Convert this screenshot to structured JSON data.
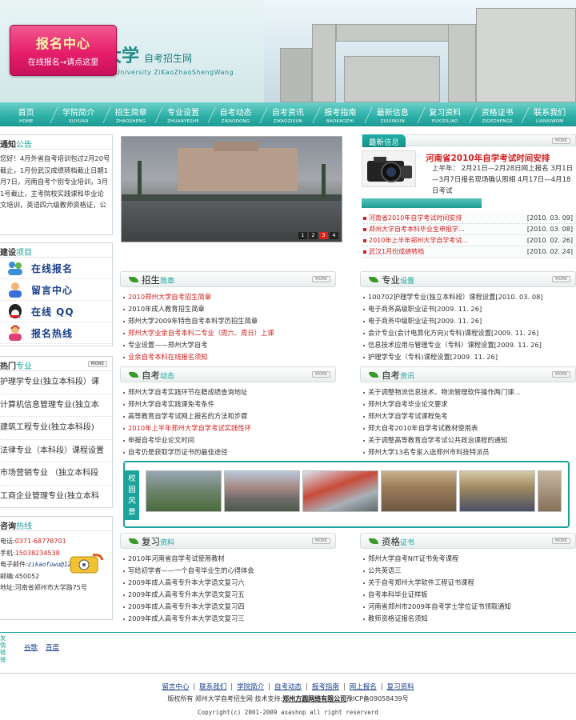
{
  "header": {
    "logo_cn": "大学",
    "logo_site": "自考招生网",
    "logo_en": "ou University ZiKaoZhaoShengWang",
    "signup_title": "报名中心",
    "signup_sub": "在线报名→请点这里"
  },
  "nav": [
    {
      "cn": "首页",
      "en": "HOME"
    },
    {
      "cn": "学院简介",
      "en": "XUYUAN"
    },
    {
      "cn": "招生简章",
      "en": "ZHAOSHENG"
    },
    {
      "cn": "专业设置",
      "en": "ZHUANYESHE"
    },
    {
      "cn": "自考动态",
      "en": "ZIKAODONG"
    },
    {
      "cn": "自考资讯",
      "en": "ZIKAOZIXUN"
    },
    {
      "cn": "报考指南",
      "en": "BAOKAOZHI"
    },
    {
      "cn": "最新信息",
      "en": "ZUIXINXIN"
    },
    {
      "cn": "复习资料",
      "en": "FUXIZILIAO"
    },
    {
      "cn": "资格证书",
      "en": "ZIGEZHENGS"
    },
    {
      "cn": "联系我们",
      "en": "LIANXIWOM"
    }
  ],
  "notice": {
    "title_a": "通知",
    "title_b": "公告",
    "text": "您好！4月外省自考培训包过2月20号截止，1月份武汉成绩转档截止日期1月7日，河南自考个别专业培训，3月1号截止，主考院校实践课和毕业论文培训，英语四六级教师资格证，公"
  },
  "services": {
    "title_a": "建设",
    "title_b": "项目",
    "items": [
      "在线报名",
      "留言中心",
      "在线 QQ",
      "报名热线"
    ]
  },
  "majors": {
    "title_a": "热门",
    "title_b": "专业",
    "more": "MORE",
    "items": [
      "护理学专业(独立本科段）课",
      "计算机信息管理专业(独立本",
      "建筑工程专业(独立本科段)",
      "法律专业（本科段）课程设置",
      "市场营销专业 （独立本科段",
      "工商企业管理专业(独立本科"
    ]
  },
  "contact": {
    "title_a": "咨询",
    "title_b": "热线",
    "phone_label": "电话:",
    "phone": "0371-68778701",
    "mobile_label": "手机:",
    "mobile": "15038234538",
    "email_label": "电子邮件:",
    "email": "zikaofuwu@126.com",
    "zip_label": "邮编:",
    "zip": "450052",
    "addr_label": "地址:",
    "addr": "河南省郑州市大学路75号"
  },
  "slideshow": {
    "pages": [
      "1",
      "2",
      "3",
      "4"
    ],
    "active": 2
  },
  "news": {
    "tab_a": "最新",
    "tab_b": "信息",
    "more": "MORE",
    "headline": "河南省2010年自学考试时间安排",
    "desc": "上半年：  2月21日—2月28日网上报名 3月1日—3月7日报名现场确认照相 4月17日—4月18日考试",
    "list": [
      {
        "title": "河南省2010年自学考试时间安排",
        "date": "[2010. 03. 09]"
      },
      {
        "title": "郑州大学自考本科毕业生申报学...",
        "date": "[2010. 03. 08]"
      },
      {
        "title": "2010年上半年郑州大学自学考试...",
        "date": "[2010. 02. 26]"
      },
      {
        "title": "武汉1月份成绩转档",
        "date": "[2010. 02. 24]"
      }
    ]
  },
  "sections": {
    "zhaosheng": {
      "title_a": "招生",
      "title_b": "简章",
      "more": "MORE",
      "items": [
        {
          "t": "2010郑州大学自考招生简章",
          "red": true
        },
        {
          "t": "2010年成人教育招生简章",
          "red": false
        },
        {
          "t": "郑州大学2009年特色自考本科学历招生简章",
          "red": false
        },
        {
          "t": "郑州大学业余自考本科二专业（周六、周日）上课",
          "red": true
        },
        {
          "t": "专业设置——郑州大学自考",
          "red": false
        },
        {
          "t": "业余自考本科在线报名须知",
          "red": true
        }
      ]
    },
    "zhuanye": {
      "title_a": "专业",
      "title_b": "设置",
      "more": "MORE",
      "items": [
        {
          "t": "100702护理学专业(独立本科段）课程设置[2010. 03. 08]",
          "red": false
        },
        {
          "t": "电子商务高级职业证书[2009. 11. 26]",
          "red": false
        },
        {
          "t": "电子商务中级职业证书[2009. 11. 26]",
          "red": false
        },
        {
          "t": "会计专业(会计电算化方向)(专科)课程设置[2009. 11. 26]",
          "red": false
        },
        {
          "t": "信息技术应用与管理专业（专科）课程设置[2009. 11. 26]",
          "red": false
        },
        {
          "t": "护理学专业（专科)课程设置[2009. 11. 26]",
          "red": false
        }
      ]
    },
    "dongtai": {
      "title_a": "自考",
      "title_b": "动态",
      "more": "MORE",
      "items": [
        {
          "t": "郑州大学自考实践环节在籍成绩查询地址",
          "red": false
        },
        {
          "t": "郑州大学自考实践课免考条件",
          "red": false
        },
        {
          "t": "高等教育自学考试网上报名的方法和步骤",
          "red": false
        },
        {
          "t": "2010年上半年郑州大学自学考试实践性环",
          "red": true
        },
        {
          "t": "申报自考毕业论文时间",
          "red": false
        },
        {
          "t": "自考仍是获取学历证书的最佳途径",
          "red": false
        }
      ]
    },
    "zixun": {
      "title_a": "自考",
      "title_b": "资讯",
      "more": "MORE",
      "items": [
        {
          "t": "关于调整物流信息技术、物流管理软件操作两门课...",
          "red": false
        },
        {
          "t": "郑州大学自考毕业论文要求",
          "red": false
        },
        {
          "t": "郑州大学自学考试课程免考",
          "red": false
        },
        {
          "t": "郑大自考2010年自学考试教材使用表",
          "red": false
        },
        {
          "t": "关于调整高等教育自学考试公共政治课程的通知",
          "red": false
        },
        {
          "t": "郑州大学13名专家入选郑州市科技特派员",
          "red": false
        }
      ]
    },
    "fuxi": {
      "title_a": "复习",
      "title_b": "资料",
      "more": "MORE",
      "items": [
        {
          "t": "2010年河南省自学考试使用教材",
          "red": false
        },
        {
          "t": "写给初学者——一个自考毕业生的心得体会",
          "red": false
        },
        {
          "t": "2009年成人高考专升本大学语文复习六",
          "red": false
        },
        {
          "t": "2009年成人高考专升本大学语文复习五",
          "red": false
        },
        {
          "t": "2009年成人高考专升本大学语文复习四",
          "red": false
        },
        {
          "t": "2009年成人高考专升本大学语文复习三",
          "red": false
        }
      ]
    },
    "zige": {
      "title_a": "资格",
      "title_b": "证书",
      "more": "MORE",
      "items": [
        {
          "t": "郑州大学自考NIT证书免考课程",
          "red": false
        },
        {
          "t": "公共英语三",
          "red": false
        },
        {
          "t": "关于自考郑州大学软件工程证书课程",
          "red": false
        },
        {
          "t": "自考本科毕业证样板",
          "red": false
        },
        {
          "t": "河南省郑州市2009年自考学士学位证书领取通知",
          "red": false
        },
        {
          "t": "教师资格证报名须知",
          "red": false
        }
      ]
    }
  },
  "campus": {
    "label": "校园风景"
  },
  "links": {
    "label": "友情链接",
    "items": [
      "谷歌",
      "百度"
    ]
  },
  "footer": {
    "nav": [
      "留言中心",
      "联系我们",
      "学院简介",
      "自考动态",
      "报考指南",
      "网上报名",
      "复习资料"
    ],
    "sep": "|",
    "copy_a": "版权所有 郑州大学自考招生网 技术支持:",
    "copy_co": "郑州方圆网络有限公司",
    "copy_b": "豫ICP备09058439号",
    "copyright": "Copyright(c) 2001-2009 axashop all right reserverd"
  }
}
